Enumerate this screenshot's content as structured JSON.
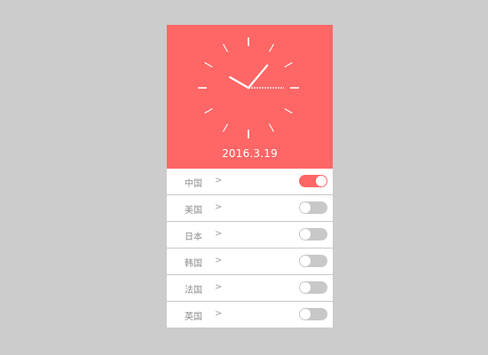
{
  "clock": {
    "date": "2016.3.19",
    "hour_hand_angle_deg": 40,
    "minute_hand_angle_deg": 90,
    "second_hand_angle_deg": 300
  },
  "countries": [
    {
      "name": "中国",
      "chevron": ">",
      "enabled": true
    },
    {
      "name": "美国",
      "chevron": ">",
      "enabled": false
    },
    {
      "name": "日本",
      "chevron": ">",
      "enabled": false
    },
    {
      "name": "韩国",
      "chevron": ">",
      "enabled": false
    },
    {
      "name": "法国",
      "chevron": ">",
      "enabled": false
    },
    {
      "name": "英国",
      "chevron": ">",
      "enabled": false
    }
  ],
  "colors": {
    "accent": "#ff6666",
    "toggle_off": "#c8c8c8",
    "background": "#cccccc"
  }
}
